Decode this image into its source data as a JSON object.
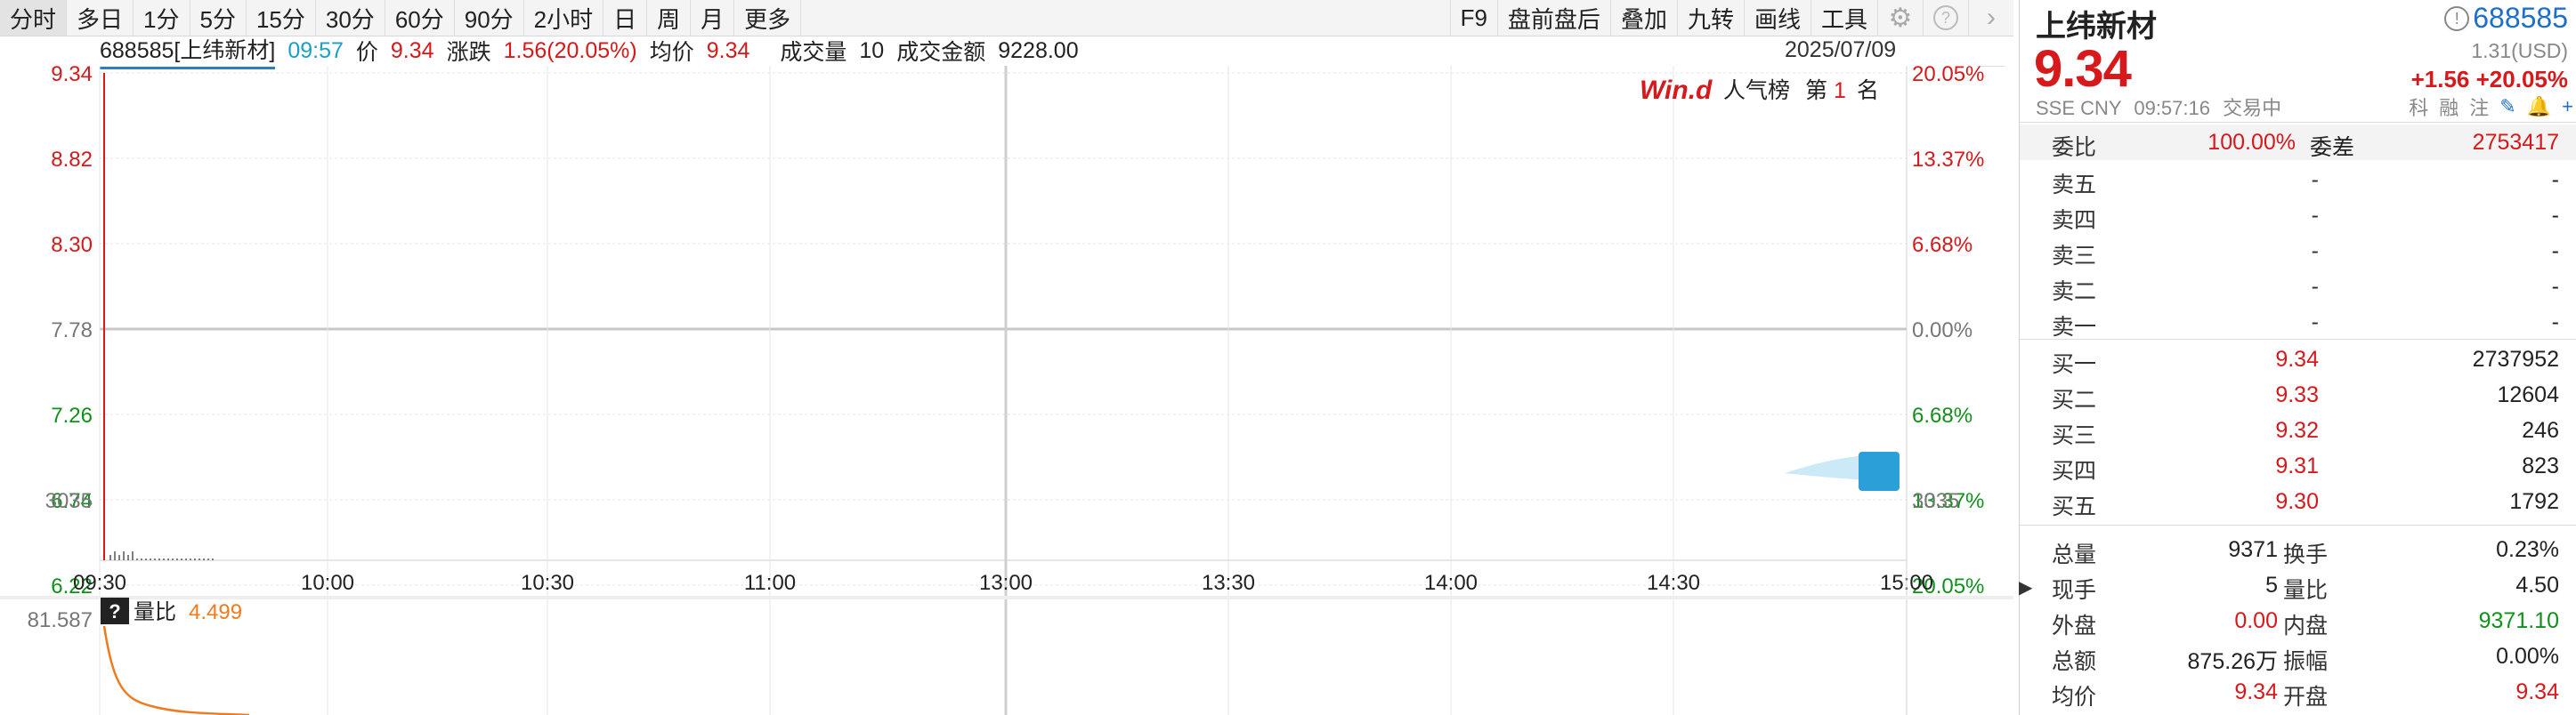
{
  "toolbar": {
    "periods": [
      "分时",
      "多日",
      "1分",
      "5分",
      "15分",
      "30分",
      "60分",
      "90分",
      "2小时",
      "日",
      "周",
      "月",
      "更多"
    ],
    "tools": [
      "F9",
      "盘前盘后",
      "叠加",
      "九转",
      "画线",
      "工具"
    ]
  },
  "info": {
    "code_name": "688585[上纬新材]",
    "time": "09:57",
    "price_label": "价",
    "price": "9.34",
    "change_label": "涨跌",
    "change": "1.56(20.05%)",
    "avg_label": "均价",
    "avg": "9.34",
    "vol_label": "成交量",
    "vol": "10",
    "amount_label": "成交金额",
    "amount": "9228.00",
    "date": "2025/07/09"
  },
  "ranking": {
    "brand": "Win.d",
    "title": "人气榜",
    "prefix": "第",
    "rank": "1",
    "suffix": "名"
  },
  "chart_data": {
    "type": "line",
    "y_price_ticks": [
      "9.34",
      "8.82",
      "8.30",
      "7.78",
      "7.26",
      "6.74",
      "6.22"
    ],
    "y_pct_ticks": [
      "20.05%",
      "13.37%",
      "6.68%",
      "0.00%",
      "6.68%",
      "13.37%",
      "20.05%"
    ],
    "volume_tick": "3035",
    "x_ticks": [
      "09:30",
      "10:00",
      "10:30",
      "11:00",
      "13:00",
      "13:30",
      "14:00",
      "14:30",
      "15:00"
    ],
    "prev_close": 7.78,
    "ylim": [
      6.22,
      9.34
    ],
    "series": [
      {
        "values": [
          9.34,
          9.34
        ]
      }
    ],
    "volume_ratio_label": "量比",
    "volume_ratio": "4.499",
    "volume_ratio_axis": "81.587",
    "colors": {
      "up": "#d7191c",
      "down": "#11911b",
      "neutral": "#777777",
      "ratio_line": "#f07a1e"
    }
  },
  "panel": {
    "name": "上纬新材",
    "code": "688585",
    "price": "9.34",
    "usd": "1.31(USD)",
    "change": "+1.56",
    "change_pct": "+20.05%",
    "exchange": "SSE",
    "currency": "CNY",
    "time": "09:57:16",
    "status": "交易中",
    "flags": [
      "科",
      "融",
      "注"
    ],
    "wb_label": "委比",
    "wb": "100.00%",
    "wc_label": "委差",
    "wc": "2753417",
    "asks": [
      {
        "label": "卖五",
        "price": "-",
        "vol": "-"
      },
      {
        "label": "卖四",
        "price": "-",
        "vol": "-"
      },
      {
        "label": "卖三",
        "price": "-",
        "vol": "-"
      },
      {
        "label": "卖二",
        "price": "-",
        "vol": "-"
      },
      {
        "label": "卖一",
        "price": "-",
        "vol": "-"
      }
    ],
    "bids": [
      {
        "label": "买一",
        "price": "9.34",
        "vol": "2737952"
      },
      {
        "label": "买二",
        "price": "9.33",
        "vol": "12604"
      },
      {
        "label": "买三",
        "price": "9.32",
        "vol": "246"
      },
      {
        "label": "买四",
        "price": "9.31",
        "vol": "823"
      },
      {
        "label": "买五",
        "price": "9.30",
        "vol": "1792"
      }
    ],
    "stats": [
      {
        "l1": "总量",
        "v1": "9371",
        "l2": "换手",
        "v2": "0.23%"
      },
      {
        "l1": "现手",
        "v1": "5",
        "l2": "量比",
        "v2": "4.50"
      },
      {
        "l1": "外盘",
        "v1": "0.00",
        "l2": "内盘",
        "v2": "9371.10"
      },
      {
        "l1": "总额",
        "v1": "875.26万",
        "l2": "振幅",
        "v2": "0.00%"
      },
      {
        "l1": "均价",
        "v1": "9.34",
        "l2": "开盘",
        "v2": "9.34"
      }
    ]
  }
}
